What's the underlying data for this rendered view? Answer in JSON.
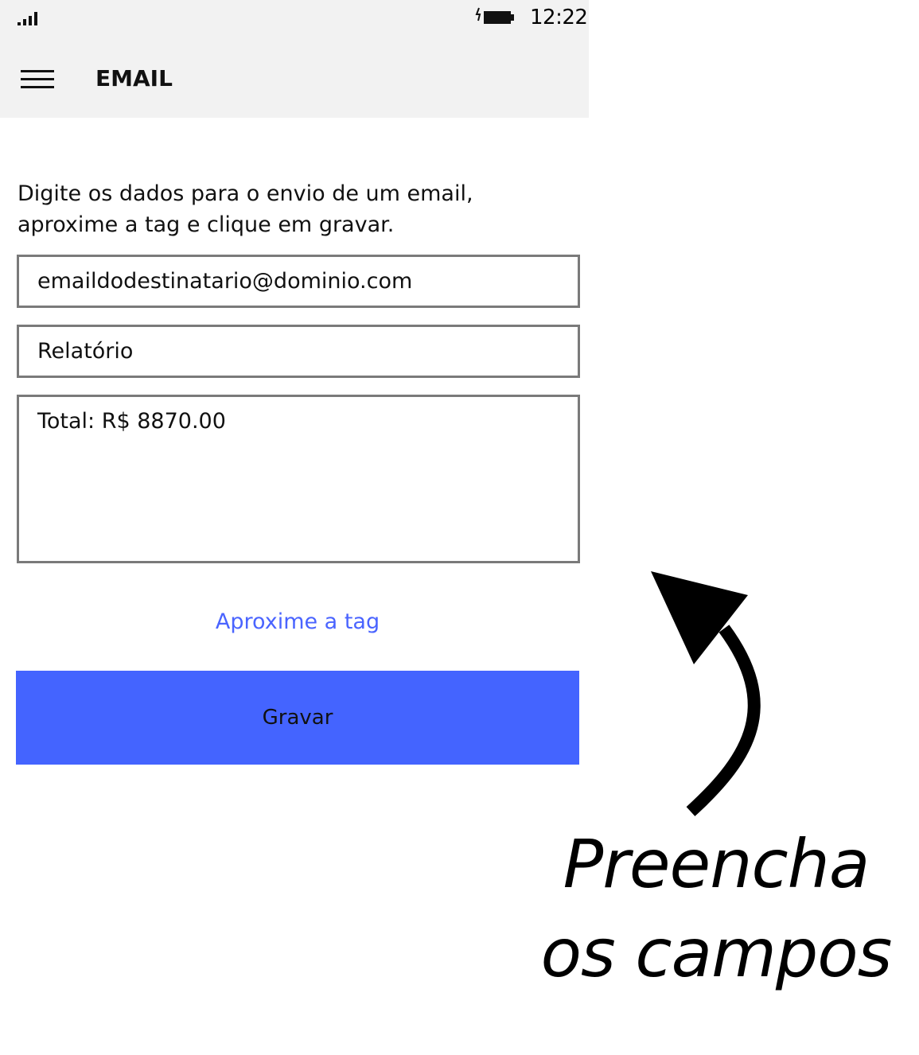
{
  "status_bar": {
    "time": "12:22",
    "signal_icon": "signal-bars-icon",
    "battery_icon": "battery-charging-icon"
  },
  "app_bar": {
    "menu_icon": "hamburger-menu-icon",
    "title": "EMAIL"
  },
  "form": {
    "instructions": "Digite os dados para o envio de um email, aproxime a tag e clique em gravar.",
    "email_value": "emaildodestinatario@dominio.com",
    "subject_value": "Relatório",
    "body_value": "Total: R$ 8870.00",
    "hint_link": "Aproxime a tag",
    "save_label": "Gravar"
  },
  "annotation": {
    "callout_line1": "Preencha",
    "callout_line2": "os campos",
    "arrow_icon": "curved-arrow-icon"
  },
  "colors": {
    "header_bg": "#f2f2f2",
    "accent": "#4464ff",
    "link": "#4a64ff",
    "field_border": "#7a7a7a"
  }
}
